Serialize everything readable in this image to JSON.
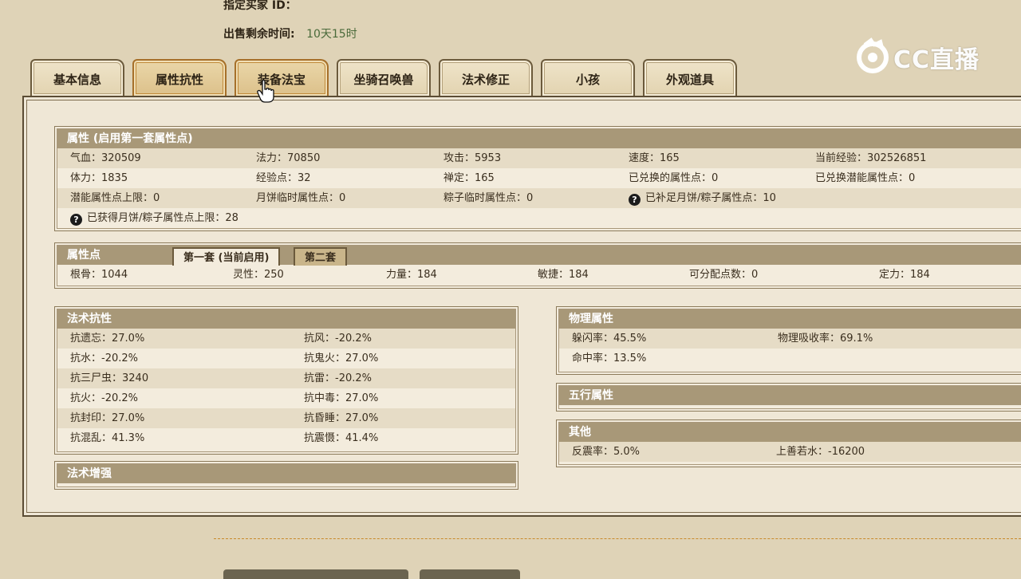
{
  "header": {
    "buyer_label": "指定买家 ID：",
    "remain_label": "出售剩余时间:",
    "remain_value": "10天15时"
  },
  "watermark": {
    "text": "CC直播"
  },
  "tabs": [
    {
      "label": "基本信息",
      "active": false
    },
    {
      "label": "属性抗性",
      "active": true
    },
    {
      "label": "装备法宝",
      "active": true
    },
    {
      "label": "坐骑召唤兽",
      "active": false
    },
    {
      "label": "法术修正",
      "active": false
    },
    {
      "label": "小孩",
      "active": false
    },
    {
      "label": "外观道具",
      "active": false
    }
  ],
  "attributes": {
    "title": "属性 (启用第一套属性点)",
    "rows": [
      [
        "气血：320509",
        "法力：70850",
        "攻击：5953",
        "速度：165",
        "当前经验：302526851"
      ],
      [
        "体力：1835",
        "经验点：32",
        "禅定：165",
        "已兑换的属性点：0",
        "已兑换潜能属性点：0"
      ],
      [
        "潜能属性点上限：0",
        "月饼临时属性点：0",
        "粽子临时属性点：0",
        "已补足月饼/粽子属性点：10",
        ""
      ],
      [
        "已获得月饼/粽子属性点上限：28"
      ]
    ]
  },
  "points": {
    "title": "属性点",
    "subtab_active": "第一套 (当前启用)",
    "subtab_other": "第二套",
    "values": [
      "根骨：1044",
      "灵性：250",
      "力量：184",
      "敏捷：184",
      "可分配点数：0",
      "定力：184"
    ]
  },
  "spell_resist": {
    "title": "法术抗性",
    "rows": [
      [
        "抗遗忘：27.0%",
        "抗风：-20.2%"
      ],
      [
        "抗水：-20.2%",
        "抗鬼火：27.0%"
      ],
      [
        "抗三尸虫：3240",
        "抗雷：-20.2%"
      ],
      [
        "抗火：-20.2%",
        "抗中毒：27.0%"
      ],
      [
        "抗封印：27.0%",
        "抗昏睡：27.0%"
      ],
      [
        "抗混乱：41.3%",
        "抗震慑：41.4%"
      ]
    ]
  },
  "spell_boost": {
    "title": "法术增强"
  },
  "physical": {
    "title": "物理属性",
    "rows": [
      [
        "躲闪率：45.5%",
        "物理吸收率：69.1%"
      ],
      [
        "命中率：13.5%",
        ""
      ]
    ]
  },
  "five_elements": {
    "title": "五行属性"
  },
  "other": {
    "title": "其他",
    "rows": [
      [
        "反震率：5.0%",
        "上善若水：-16200"
      ]
    ]
  }
}
